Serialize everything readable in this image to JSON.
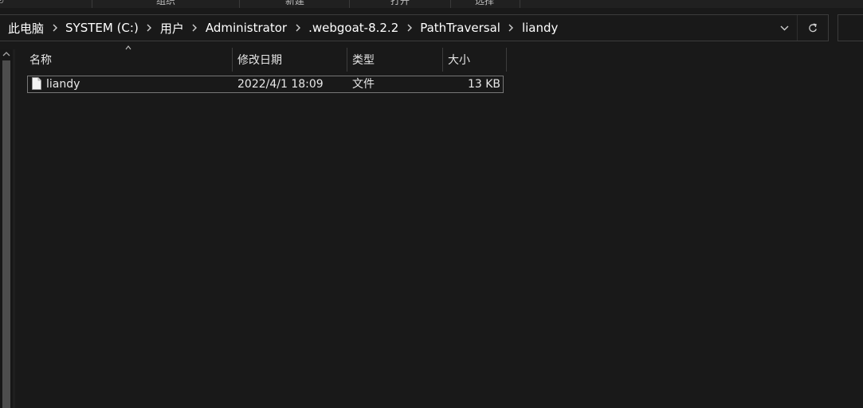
{
  "ribbon": {
    "groups": [
      "组织",
      "新建",
      "打开",
      "选择"
    ],
    "first_fragment": "ত"
  },
  "address": {
    "crumbs": [
      "此电脑",
      "SYSTEM (C:)",
      "用户",
      "Administrator",
      ".webgoat-8.2.2",
      "PathTraversal",
      "liandy"
    ],
    "dropdown_icon": "chevron-down-icon",
    "refresh_icon": "refresh-icon"
  },
  "columns": {
    "name": "名称",
    "modified": "修改日期",
    "type": "类型",
    "size": "大小"
  },
  "files": [
    {
      "name": "liandy",
      "modified": "2022/4/1 18:09",
      "type": "文件",
      "size": "13 KB",
      "icon": "file-icon"
    }
  ]
}
